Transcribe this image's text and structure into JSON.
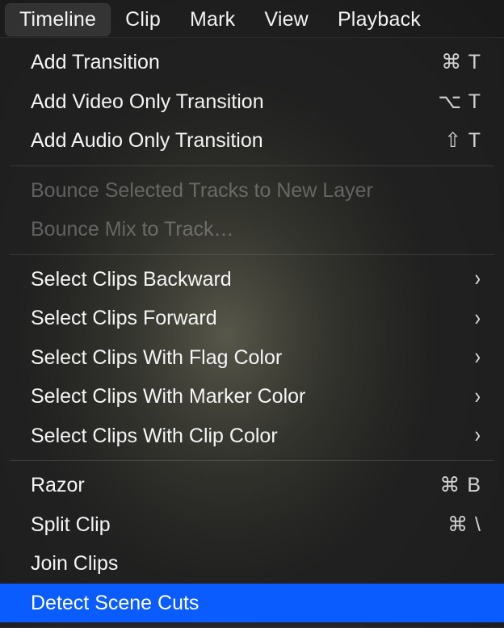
{
  "menubar": {
    "items": [
      {
        "label": "Timeline",
        "active": true
      },
      {
        "label": "Clip",
        "active": false
      },
      {
        "label": "Mark",
        "active": false
      },
      {
        "label": "View",
        "active": false
      },
      {
        "label": "Playback",
        "active": false
      }
    ]
  },
  "dropdown": {
    "sections": [
      [
        {
          "label": "Add Transition",
          "shortcut": "⌘ T",
          "submenu": false,
          "disabled": false
        },
        {
          "label": "Add Video Only Transition",
          "shortcut": "⌥ T",
          "submenu": false,
          "disabled": false
        },
        {
          "label": "Add Audio Only Transition",
          "shortcut": "⇧ T",
          "submenu": false,
          "disabled": false
        }
      ],
      [
        {
          "label": "Bounce Selected Tracks to New Layer",
          "shortcut": "",
          "submenu": false,
          "disabled": true
        },
        {
          "label": "Bounce Mix to Track…",
          "shortcut": "",
          "submenu": false,
          "disabled": true
        }
      ],
      [
        {
          "label": "Select Clips Backward",
          "shortcut": "",
          "submenu": true,
          "disabled": false
        },
        {
          "label": "Select Clips Forward",
          "shortcut": "",
          "submenu": true,
          "disabled": false
        },
        {
          "label": "Select Clips With Flag Color",
          "shortcut": "",
          "submenu": true,
          "disabled": false
        },
        {
          "label": "Select Clips With Marker Color",
          "shortcut": "",
          "submenu": true,
          "disabled": false
        },
        {
          "label": "Select Clips With Clip Color",
          "shortcut": "",
          "submenu": true,
          "disabled": false
        }
      ],
      [
        {
          "label": "Razor",
          "shortcut": "⌘ B",
          "submenu": false,
          "disabled": false
        },
        {
          "label": "Split Clip",
          "shortcut": "⌘ \\",
          "submenu": false,
          "disabled": false
        },
        {
          "label": "Join Clips",
          "shortcut": "",
          "submenu": false,
          "disabled": false
        },
        {
          "label": "Detect Scene Cuts",
          "shortcut": "",
          "submenu": false,
          "disabled": false,
          "highlighted": true
        }
      ]
    ]
  }
}
